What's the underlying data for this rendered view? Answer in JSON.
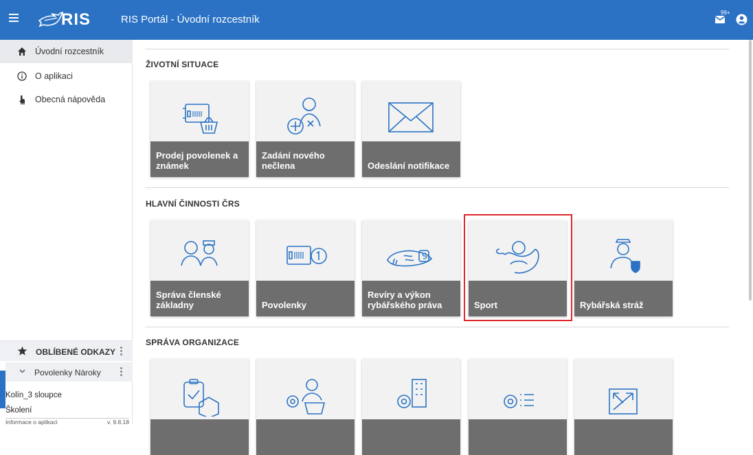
{
  "header": {
    "logo_text": "RIS",
    "title": "RIS Portál - Úvodní rozcestník",
    "mail_badge": "99+",
    "menu_icon": "hamburger-icon",
    "mail_icon": "mail-icon",
    "user_icon": "account-icon",
    "bg_color": "#2b72c4"
  },
  "sidebar": {
    "items": [
      {
        "label": "Úvodní rozcestník",
        "icon": "home-icon",
        "active": true
      },
      {
        "label": "O aplikaci",
        "icon": "info-icon"
      },
      {
        "label": "Obecná nápověda",
        "icon": "help-icon"
      }
    ],
    "favorites": {
      "title": "OBLÍBENÉ ODKAZY",
      "group": "Povolenky Nároky",
      "links": [
        "Kolín_3 sloupce",
        "Školení"
      ]
    },
    "footer": {
      "label": "Informace o aplikaci",
      "version": "v. 9.8.18"
    }
  },
  "sections": [
    {
      "title": "ŽIVOTNÍ SITUACE",
      "tiles": [
        {
          "label": "Prodej povolenek a známek",
          "icon": "permit-basket-icon"
        },
        {
          "label": "Zadání nového nečlena",
          "icon": "add-person-icon"
        },
        {
          "label": "Odeslání notifikace",
          "icon": "envelope-icon"
        }
      ]
    },
    {
      "title": "HLAVNÍ ČINNOSTI ČRS",
      "tiles": [
        {
          "label": "Správa členské základny",
          "icon": "members-icon"
        },
        {
          "label": "Povolenky",
          "icon": "permit-coin-icon"
        },
        {
          "label": "Revíry a výkon rybářského práva",
          "icon": "fishing-area-icon"
        },
        {
          "label": "Sport",
          "icon": "angler-icon"
        },
        {
          "label": "Rybářská stráž",
          "icon": "guard-icon"
        }
      ]
    },
    {
      "title": "SPRÁVA ORGANIZACE",
      "tiles": [
        {
          "label": "",
          "icon": "clipboard-box-icon"
        },
        {
          "label": "",
          "icon": "settings-person-icon"
        },
        {
          "label": "",
          "icon": "settings-building-icon"
        },
        {
          "label": "",
          "icon": "settings-list-icon"
        },
        {
          "label": "",
          "icon": "arrows-icon"
        }
      ]
    }
  ]
}
